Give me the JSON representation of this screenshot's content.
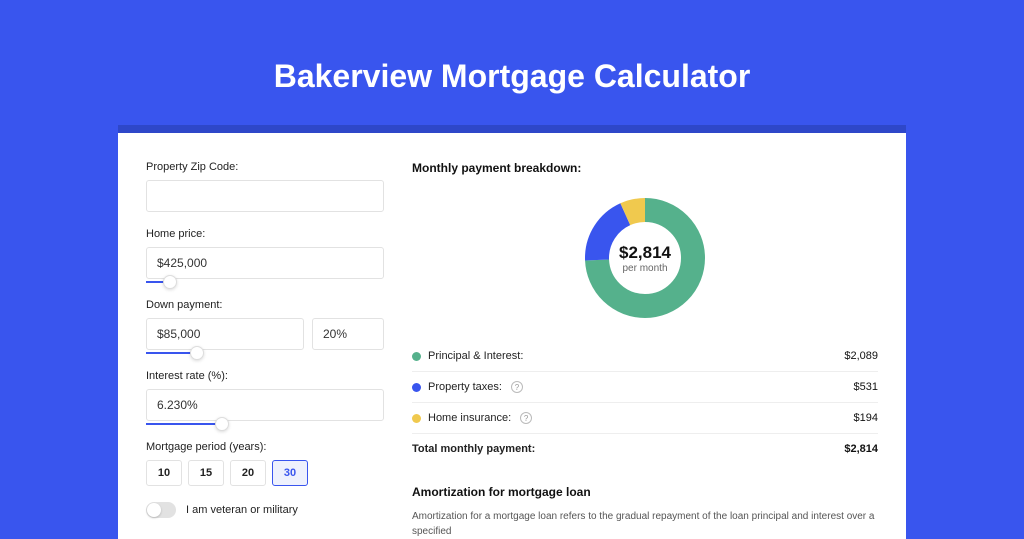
{
  "page": {
    "title": "Bakerview Mortgage Calculator"
  },
  "form": {
    "zip": {
      "label": "Property Zip Code:",
      "value": ""
    },
    "home_price": {
      "label": "Home price:",
      "value": "$425,000"
    },
    "down_payment": {
      "label": "Down payment:",
      "amount": "$85,000",
      "percent": "20%"
    },
    "interest_rate": {
      "label": "Interest rate (%):",
      "value": "6.230%"
    },
    "period": {
      "label": "Mortgage period (years):",
      "options": [
        "10",
        "15",
        "20",
        "30"
      ],
      "selected": "30"
    },
    "veteran": {
      "label": "I am veteran or military",
      "value": false
    }
  },
  "breakdown": {
    "title": "Monthly payment breakdown:",
    "center_amount": "$2,814",
    "center_sub": "per month",
    "rows": [
      {
        "label": "Principal & Interest:",
        "value": "$2,089",
        "color": "#55b18c",
        "info": false
      },
      {
        "label": "Property taxes:",
        "value": "$531",
        "color": "#3955ee",
        "info": true
      },
      {
        "label": "Home insurance:",
        "value": "$194",
        "color": "#f0c94e",
        "info": true
      }
    ],
    "total": {
      "label": "Total monthly payment:",
      "value": "$2,814"
    }
  },
  "amortization": {
    "title": "Amortization for mortgage loan",
    "body": "Amortization for a mortgage loan refers to the gradual repayment of the loan principal and interest over a specified"
  },
  "chart_data": {
    "type": "pie",
    "title": "Monthly payment breakdown",
    "series": [
      {
        "name": "Principal & Interest",
        "value": 2089,
        "color": "#55b18c"
      },
      {
        "name": "Property taxes",
        "value": 531,
        "color": "#3955ee"
      },
      {
        "name": "Home insurance",
        "value": 194,
        "color": "#f0c94e"
      }
    ],
    "total": 2814,
    "center_label": "$2,814 per month"
  }
}
